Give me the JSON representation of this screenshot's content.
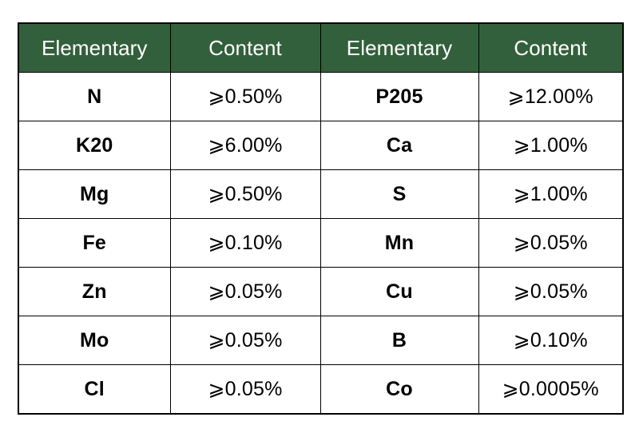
{
  "table": {
    "headers": [
      "Elementary",
      "Content",
      "Elementary",
      "Content"
    ],
    "rows": [
      {
        "elem_left": "N",
        "content_left": "⩾0.50%",
        "elem_right": "P205",
        "content_right": "⩾12.00%"
      },
      {
        "elem_left": "K20",
        "content_left": "⩾6.00%",
        "elem_right": "Ca",
        "content_right": "⩾1.00%"
      },
      {
        "elem_left": "Mg",
        "content_left": "⩾0.50%",
        "elem_right": "S",
        "content_right": "⩾1.00%"
      },
      {
        "elem_left": "Fe",
        "content_left": "⩾0.10%",
        "elem_right": "Mn",
        "content_right": "⩾0.05%"
      },
      {
        "elem_left": "Zn",
        "content_left": "⩾0.05%",
        "elem_right": "Cu",
        "content_right": "⩾0.05%"
      },
      {
        "elem_left": "Mo",
        "content_left": "⩾0.05%",
        "elem_right": "B",
        "content_right": "⩾0.10%"
      },
      {
        "elem_left": "Cl",
        "content_left": "⩾0.05%",
        "elem_right": "Co",
        "content_right": "⩾0.0005%"
      }
    ]
  },
  "colors": {
    "header_background": "#33603C",
    "header_text": "#FFFFFF",
    "border": "#000000",
    "cell_background": "#FFFFFF",
    "cell_text": "#000000"
  }
}
